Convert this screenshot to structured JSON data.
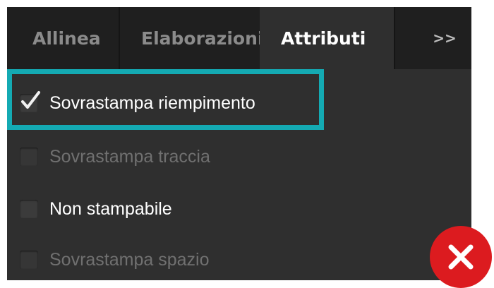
{
  "tabs": [
    {
      "label": "Allinea",
      "active": false
    },
    {
      "label": "Elaborazioni tracciato",
      "active": false
    },
    {
      "label": "Attributi",
      "active": true
    }
  ],
  "overflow_button": {
    "label": "»​",
    "glyph": ">>"
  },
  "options": [
    {
      "label": "Sovrastampa riempimento",
      "checked": true,
      "enabled": true
    },
    {
      "label": "Sovrastampa traccia",
      "checked": false,
      "enabled": false
    },
    {
      "label": "Non stampabile",
      "checked": false,
      "enabled": true
    },
    {
      "label": "Sovrastampa spazio",
      "checked": false,
      "enabled": false
    }
  ],
  "highlight": {
    "color": "#14aab3",
    "target": "Sovrastampa riempimento"
  },
  "badge": {
    "icon": "close-icon",
    "color": "#dc1b1f"
  },
  "colors": {
    "panel": "#2f2f2f",
    "tabbar": "#1f1f1f",
    "text": "#ffffff",
    "disabled_text": "#707070"
  }
}
